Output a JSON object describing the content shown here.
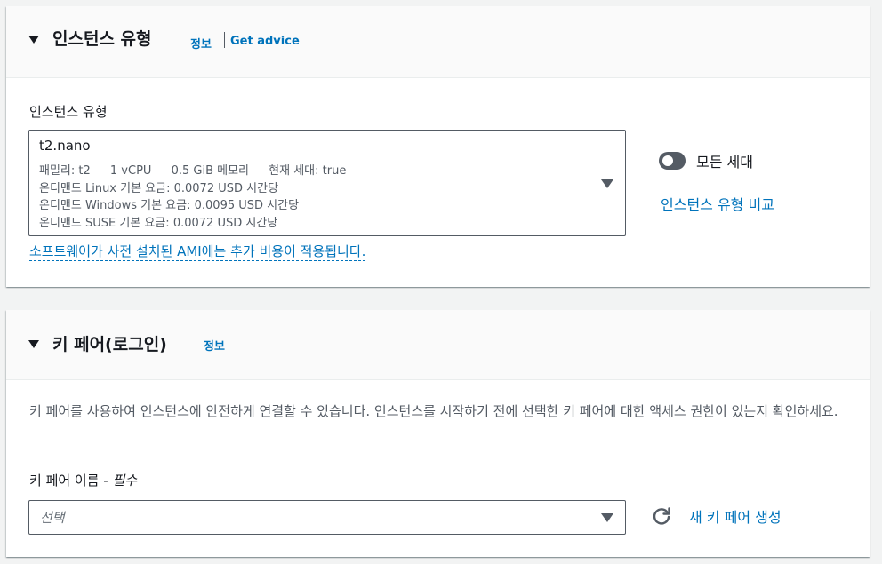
{
  "instance_type_section": {
    "title": "인스턴스 유형",
    "info_link": "정보",
    "advice_link": "Get advice",
    "field_label": "인스턴스 유형",
    "selected": {
      "name": "t2.nano",
      "family": "패밀리: t2",
      "vcpu": "1 vCPU",
      "memory": "0.5 GiB 메모리",
      "generation": "현재 세대: true",
      "linux_price": "온디맨드 Linux 기본 요금: 0.0072 USD 시간당",
      "windows_price": "온디맨드 Windows 기본 요금: 0.0095 USD 시간당",
      "suse_price": "온디맨드 SUSE 기본 요금: 0.0072 USD 시간당"
    },
    "all_generations_label": "모든 세대",
    "all_generations_on": false,
    "compare_link": "인스턴스 유형 비교",
    "ami_note": "소프트웨어가 사전 설치된 AMI에는 추가 비용이 적용됩니다."
  },
  "key_pair_section": {
    "title": "키 페어(로그인)",
    "info_link": "정보",
    "description": "키 페어를 사용하여 인스턴스에 안전하게 연결할 수 있습니다. 인스턴스를 시작하기 전에 선택한 키 페어에 대한 액세스 권한이 있는지 확인하세요.",
    "field_label": "키 페어 이름 - ",
    "field_required": "필수",
    "select_placeholder": "선택",
    "new_key_link": "새 키 페어 생성"
  },
  "colors": {
    "link": "#0073bb",
    "text": "#16191f",
    "secondary_text": "#545b64",
    "header_bg": "#fafafa",
    "page_bg": "#f2f3f3"
  }
}
